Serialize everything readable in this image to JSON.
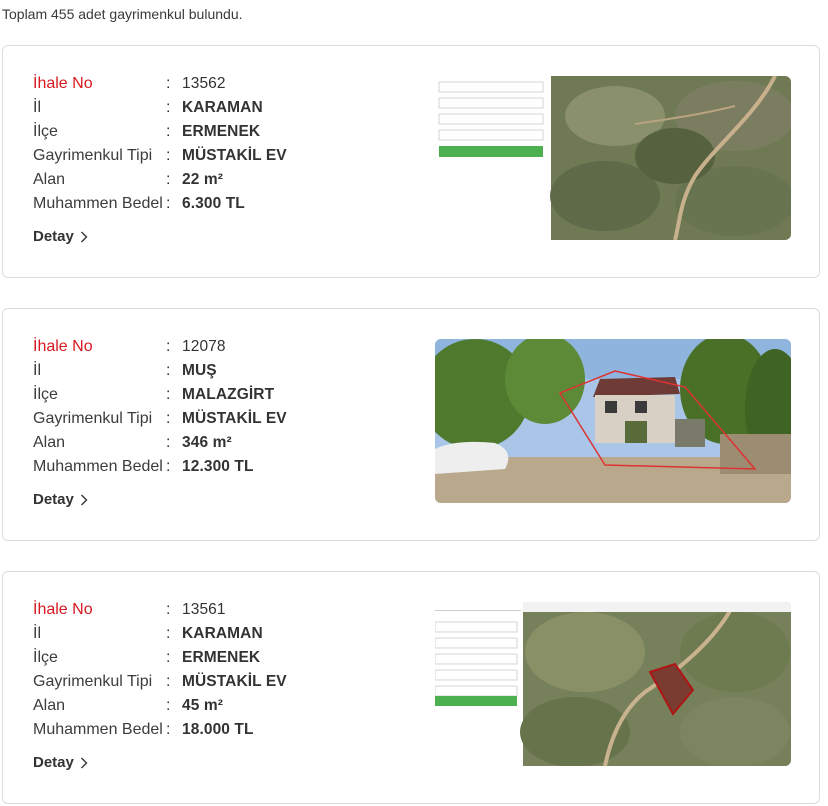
{
  "summary_text": "Toplam 455 adet gayrimenkul bulundu.",
  "labels": {
    "ihale_no": "İhale No",
    "il": "İl",
    "ilce": "İlçe",
    "tip": "Gayrimenkul Tipi",
    "alan": "Alan",
    "bedel": "Muhammen Bedel",
    "colon": ":",
    "detay": "Detay"
  },
  "listings": [
    {
      "ihale_no": "13562",
      "il": "KARAMAN",
      "ilce": "ERMENEK",
      "tip": "MÜSTAKİL EV",
      "alan": "22 m²",
      "bedel": "6.300 TL",
      "image": "satellite-map-screenshot"
    },
    {
      "ihale_no": "12078",
      "il": "MUŞ",
      "ilce": "MALAZGİRT",
      "tip": "MÜSTAKİL EV",
      "alan": "346 m²",
      "bedel": "12.300 TL",
      "image": "house-photo"
    },
    {
      "ihale_no": "13561",
      "il": "KARAMAN",
      "ilce": "ERMENEK",
      "tip": "MÜSTAKİL EV",
      "alan": "45 m²",
      "bedel": "18.000 TL",
      "image": "satellite-map-screenshot"
    }
  ],
  "colors": {
    "accent_red": "#d71920",
    "border": "#dcdcdc",
    "green_button": "#4caf50"
  }
}
